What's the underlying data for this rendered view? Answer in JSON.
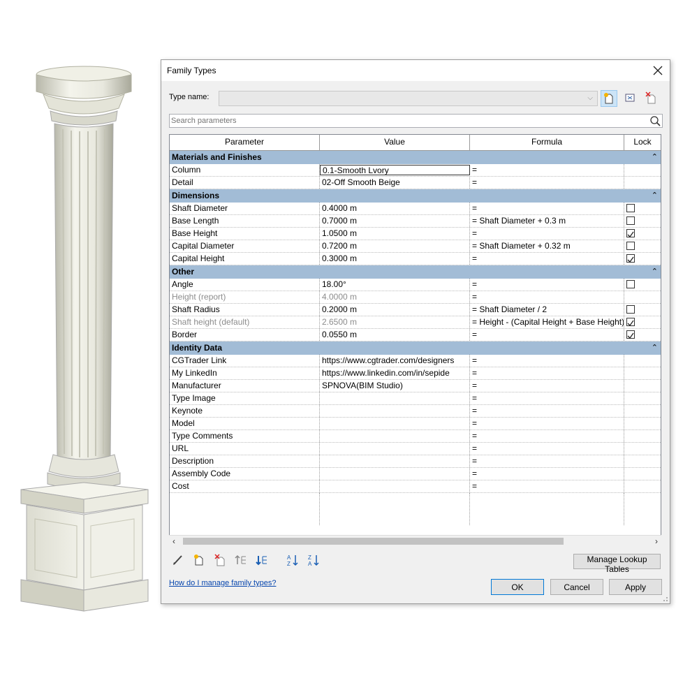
{
  "dialog": {
    "title": "Family Types",
    "type_name_label": "Type name:",
    "type_name_value": "",
    "search_placeholder": "Search parameters",
    "headers": {
      "parameter": "Parameter",
      "value": "Value",
      "formula": "Formula",
      "lock": "Lock"
    },
    "groups": [
      {
        "name": "Materials and Finishes",
        "rows": [
          {
            "parameter": "Column",
            "value": "0.1-Smooth Lvory",
            "formula": "=",
            "lock": null,
            "editing": true
          },
          {
            "parameter": "Detail",
            "value": "02-Off Smooth Beige",
            "formula": "=",
            "lock": null
          }
        ]
      },
      {
        "name": "Dimensions",
        "rows": [
          {
            "parameter": "Shaft Diameter",
            "value": "0.4000 m",
            "formula": "=",
            "lock": false
          },
          {
            "parameter": "Base Length",
            "value": "0.7000 m",
            "formula": "= Shaft Diameter + 0.3 m",
            "lock": false
          },
          {
            "parameter": "Base Height",
            "value": "1.0500 m",
            "formula": "=",
            "lock": true
          },
          {
            "parameter": "Capital Diameter",
            "value": "0.7200 m",
            "formula": "= Shaft Diameter + 0.32 m",
            "lock": false
          },
          {
            "parameter": "Capital Height",
            "value": "0.3000 m",
            "formula": "=",
            "lock": true
          }
        ]
      },
      {
        "name": "Other",
        "rows": [
          {
            "parameter": "Angle",
            "value": "18.00°",
            "formula": "=",
            "lock": false
          },
          {
            "parameter": "Height (report)",
            "value": "4.0000 m",
            "formula": "=",
            "lock": null,
            "greyed": true
          },
          {
            "parameter": "Shaft Radius",
            "value": "0.2000 m",
            "formula": "= Shaft Diameter / 2",
            "lock": false
          },
          {
            "parameter": "Shaft height (default)",
            "value": "2.6500 m",
            "formula": "= Height - (Capital Height + Base Height)",
            "lock": true,
            "greyed": true
          },
          {
            "parameter": "Border",
            "value": "0.0550 m",
            "formula": "=",
            "lock": true
          }
        ]
      },
      {
        "name": "Identity Data",
        "rows": [
          {
            "parameter": "CGTrader Link",
            "value": "https://www.cgtrader.com/designers",
            "formula": "=",
            "lock": null
          },
          {
            "parameter": "My LinkedIn",
            "value": "https://www.linkedin.com/in/sepide",
            "formula": "=",
            "lock": null
          },
          {
            "parameter": "Manufacturer",
            "value": "SPNOVA(BIM Studio)",
            "formula": "=",
            "lock": null
          },
          {
            "parameter": "Type Image",
            "value": "",
            "formula": "=",
            "lock": null
          },
          {
            "parameter": "Keynote",
            "value": "",
            "formula": "=",
            "lock": null
          },
          {
            "parameter": "Model",
            "value": "",
            "formula": "=",
            "lock": null
          },
          {
            "parameter": "Type Comments",
            "value": "",
            "formula": "=",
            "lock": null
          },
          {
            "parameter": "URL",
            "value": "",
            "formula": "=",
            "lock": null
          },
          {
            "parameter": "Description",
            "value": "",
            "formula": "=",
            "lock": null
          },
          {
            "parameter": "Assembly Code",
            "value": "",
            "formula": "=",
            "lock": null
          },
          {
            "parameter": "Cost",
            "value": "",
            "formula": "=",
            "lock": null
          }
        ]
      }
    ],
    "manage_lookup_label": "Manage Lookup Tables",
    "help_link": "How do I manage family types?",
    "ok_label": "OK",
    "cancel_label": "Cancel",
    "apply_label": "Apply"
  }
}
